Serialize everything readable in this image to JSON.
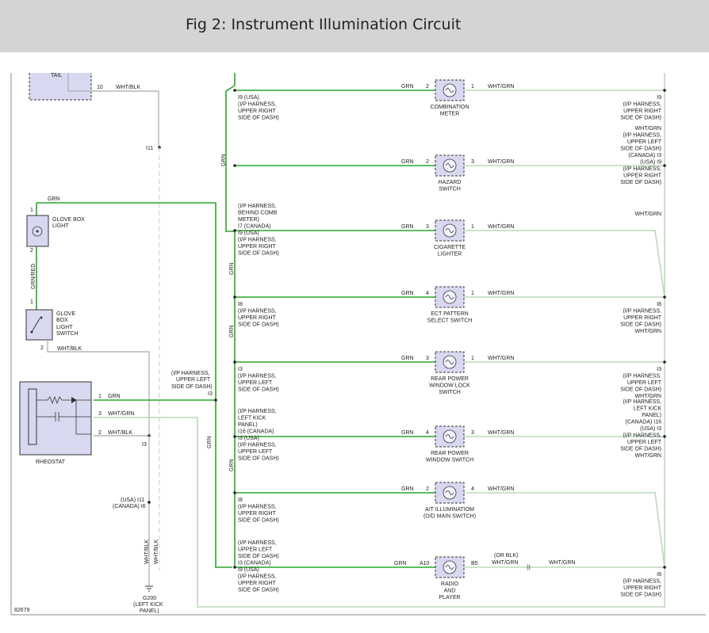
{
  "header": {
    "title": "Fig 2: Instrument Illumination Circuit"
  },
  "figure_id": "82679",
  "wire_colors": {
    "grn": "#2aa52a",
    "wht_grn": "#bcd8bc",
    "wht_blk": "#b5b5b5"
  },
  "tail": {
    "label": "TAIL",
    "pin": "10",
    "wire": "WHT/BLK"
  },
  "splice_i11": "I11",
  "glove_box_light": {
    "name": [
      "GLOVE BOX",
      "LIGHT"
    ],
    "pin_top": "1",
    "pin_bottom": "2",
    "wire_top": "GRN",
    "wire_bottom": "GRN/RED"
  },
  "glove_box_switch": {
    "name": [
      "GLOVE",
      "BOX",
      "LIGHT",
      "SWITCH"
    ],
    "pin_top": "1",
    "pin_bottom": "2",
    "wire": "WHT/BLK"
  },
  "rheostat": {
    "name": "RHEOSTAT",
    "pins": [
      {
        "pin": "1",
        "wire": "GRN"
      },
      {
        "pin": "3",
        "wire": "WHT/GRN"
      },
      {
        "pin": "2",
        "wire": "WHT/BLK"
      }
    ],
    "splice_label": "I3",
    "harness_label": [
      "(I/P HARNESS,",
      "UPPER LEFT",
      "SIDE OF DASH)"
    ],
    "harness_splice": "I3"
  },
  "ground": {
    "splice_usa": "(USA) I11",
    "splice_canada": "(CANADA) I6",
    "wire_1": "WHT/BLK",
    "wire_2": "WHT/BLK",
    "name": "G200",
    "location": [
      "(LEFT KICK",
      "PANEL)"
    ]
  },
  "bus_wire_labels": [
    "GRN",
    "GRN",
    "GRN",
    "GRN",
    "GRN"
  ],
  "components": [
    {
      "name": [
        "COMBINATION",
        "METER"
      ],
      "in_wire": "GRN",
      "in_pin": "2",
      "out_pin": "1",
      "out_wire": "WHT/GRN",
      "left_splice": [
        "I9 (USA)",
        "(I/P HARNESS,",
        "UPPER RIGHT",
        "SIDE OF DASH)"
      ],
      "right_splice": [
        "I9",
        "(I/P HARNESS,",
        "UPPER RIGHT",
        "SIDE OF DASH)"
      ]
    },
    {
      "name": [
        "HAZARD",
        "SWITCH"
      ],
      "in_wire": "GRN",
      "in_pin": "2",
      "out_pin": "3",
      "out_wire": "WHT/GRN",
      "left_splice": [],
      "right_splice": [
        "WHT/GRN",
        "(I/P HARNESS,",
        "UPPER LEFT",
        "SIDE OF DASH)",
        "(CANADA) I3",
        "(USA) I9",
        "(I/P HARNESS,",
        "UPPER RIGHT",
        "SIDE OF DASH)"
      ]
    },
    {
      "name": [
        "CIGARETTE",
        "LIGHTER"
      ],
      "in_wire": "GRN",
      "in_pin": "3",
      "out_pin": "1",
      "out_wire": "WHT/GRN",
      "left_splice": [
        "(I/P HARNESS,",
        "BEHIND COMB",
        "METER)",
        "I7 (CANADA)",
        "I9 (USA)",
        "(I/P HARNESS,",
        "UPPER RIGHT",
        "SIDE OF DASH)"
      ],
      "right_splice": [
        "WHT/GRN"
      ]
    },
    {
      "name": [
        "ECT PATTERN",
        "SELECT SWITCH"
      ],
      "in_wire": "GRN",
      "in_pin": "4",
      "out_pin": "1",
      "out_wire": "WHT/GRN",
      "left_splice": [
        "I8",
        "(I/P HARNESS,",
        "UPPER RIGHT",
        "SIDE OF DASH)"
      ],
      "right_splice": [
        "I8",
        "(I/P HARNESS,",
        "UPPER RIGHT",
        "SIDE OF DASH)",
        "WHT/GRN"
      ]
    },
    {
      "name": [
        "REAR POWER",
        "WINDOW LOCK",
        "SWITCH"
      ],
      "in_wire": "GRN",
      "in_pin": "3",
      "out_pin": "1",
      "out_wire": "WHT/GRN",
      "left_splice": [
        "I3",
        "(I/P HARNESS,",
        "UPPER LEFT",
        "SIDE OF DASH)"
      ],
      "right_splice": [
        "I3",
        "(I/P HARNESS,",
        "UPPER LEFT",
        "SIDE OF DASH)",
        "WHT/GRN"
      ]
    },
    {
      "name": [
        "REAR POWER",
        "WINDOW SWITCH"
      ],
      "in_wire": "GRN",
      "in_pin": "4",
      "out_pin": "3",
      "out_wire": "WHT/GRN",
      "left_splice": [
        "(I/P HARNESS,",
        "LEFT KICK",
        "PANEL)",
        "I16 (CANADA)",
        "I3 (USA)",
        "(I/P HARNESS,",
        "UPPER LEFT",
        "SIDE OF DASH)"
      ],
      "right_splice": [
        "(I/P HARNESS,",
        "LEFT KICK",
        "PANEL)",
        "(CANADA) I16",
        "(USA) I3",
        "(I/P HARNESS,",
        "UPPER LEFT",
        "SIDE OF DASH)",
        "WHT/GRN"
      ]
    },
    {
      "name": [
        "A/T ILLUMINATIOM",
        "(O/D MAIN SWITCH)"
      ],
      "in_wire": "GRN",
      "in_pin": "2",
      "out_pin": "4",
      "out_wire": "WHT/GRN",
      "left_splice": [
        "I8",
        "(I/P HARNESS,",
        "UPPER RIGHT",
        "SIDE OF DASH)"
      ],
      "right_splice": []
    },
    {
      "name": [
        "RADIO",
        "AND",
        "PLAYER"
      ],
      "in_wire": "GRN",
      "in_pin": "A10",
      "out_pin": "B5",
      "out_wire": "(OR BLK)",
      "out_wire_2": "WHT/GRN",
      "out_wire_3": "WHT/GRN",
      "left_splice": [
        "(I/P HARNESS,",
        "UPPER LEFT",
        "SIDE OF DASH)",
        "I3 (CANADA)",
        "I9 (USA)",
        "(I/P HARNESS,",
        "UPPER RIGHT",
        "SIDE OF DASH)"
      ],
      "right_splice": [
        "I8",
        "(I/P HARNESS,",
        "UPPER RIGHT",
        "SIDE OF DASH)"
      ]
    }
  ]
}
